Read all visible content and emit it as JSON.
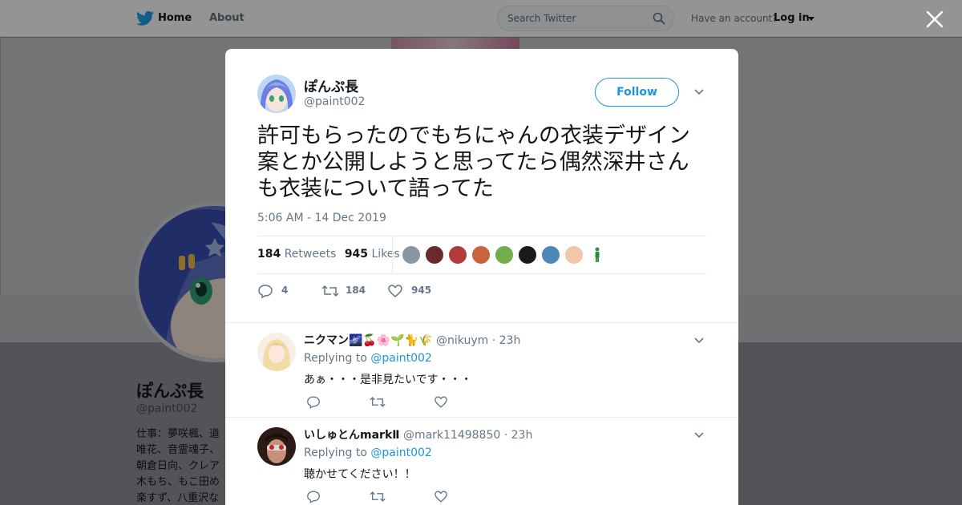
{
  "topbar": {
    "home_label": "Home",
    "about_label": "About",
    "search_placeholder": "Search Twitter",
    "have_account": "Have an account?",
    "login_label": "Log in"
  },
  "profile": {
    "name": "ぽんぷ長",
    "handle": "@paint002",
    "bio_lines": [
      "仕事：夢咲楓、道",
      "唯花、音霊魂子、",
      "朝倉日向、クレア",
      "木もち、もこ田め",
      "楽すず、八重沢な"
    ]
  },
  "tweet": {
    "author_name": "ぽんぷ長",
    "author_handle": "@paint002",
    "follow_label": "Follow",
    "text": "許可もらったのでもちにゃんの衣装デザイン案とか公開しようと思ってたら偶然深井さんも衣装について語ってた",
    "timestamp": "5:06 AM - 14 Dec 2019",
    "retweets_count": "184",
    "retweets_label": "Retweets",
    "likes_count": "945",
    "likes_label": "Likes",
    "reply_action_count": "4",
    "retweet_action_count": "184",
    "like_action_count": "945",
    "liker_colors": [
      "#8a96a3",
      "#6b2a2a",
      "#b23a3a",
      "#c8643e",
      "#6fae4b",
      "#1a1a1a",
      "#4f86b8",
      "#f2c6a8",
      "#2e8b3e"
    ]
  },
  "replies": [
    {
      "name": "ニクマン🌌🍒🌸🌱🐈🌾",
      "handle": "@nikuym",
      "time": "23h",
      "replying_prefix": "Replying to",
      "replying_to": "@paint002",
      "text": "あぁ・・・是非見たいです・・・"
    },
    {
      "name": "いしゅとんmarkⅡ",
      "handle": "@mark11498850",
      "time": "23h",
      "replying_prefix": "Replying to",
      "replying_to": "@paint002",
      "text": "聴かせてください！！"
    }
  ],
  "colors": {
    "twitter_blue": "#1b95e0",
    "text_primary": "#14171a",
    "text_secondary": "#657786"
  }
}
